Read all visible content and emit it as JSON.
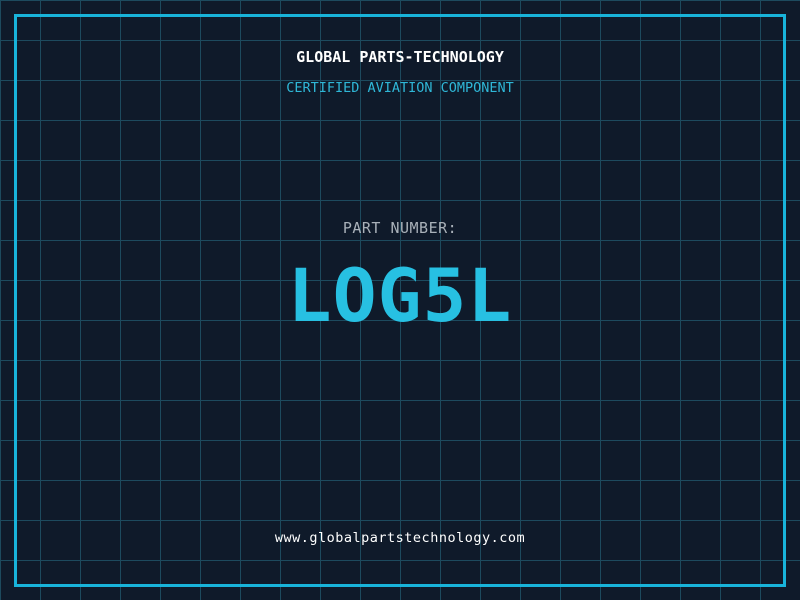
{
  "page": {
    "background_color": "#0f1a2a",
    "grid_color": "#1d4a5e",
    "frame_color": "#18b3da"
  },
  "header": {
    "title": "GLOBAL PARTS-TECHNOLOGY",
    "title_color": "#ffffff",
    "subtitle": "CERTIFIED AVIATION COMPONENT",
    "subtitle_color": "#2fb7d7"
  },
  "part": {
    "label": "PART NUMBER:",
    "label_color": "#a9b1b9",
    "number": "LOG5L",
    "number_color": "#27c0e2"
  },
  "footer": {
    "url": "www.globalpartstechnology.com",
    "color": "#ffffff"
  }
}
